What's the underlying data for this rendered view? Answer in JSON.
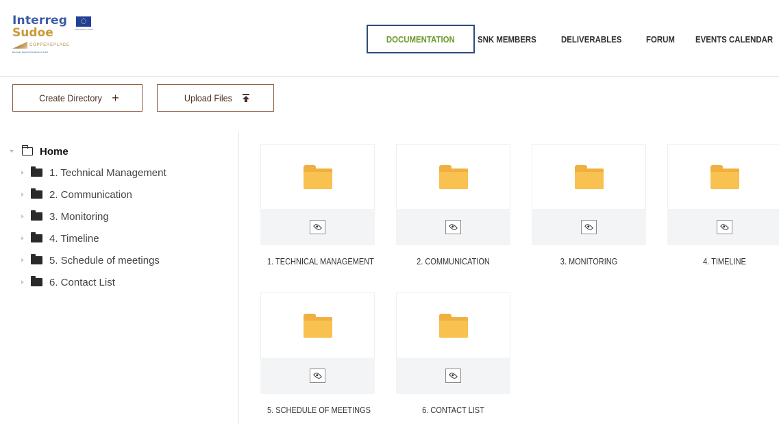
{
  "header": {
    "logo": {
      "line1": "Interreg",
      "line2": "Sudoe",
      "project": "COPPEREPLACE",
      "fund_caption": "European Regional Development Fund",
      "eu_caption": "EUROPEAN UNION"
    },
    "nav": [
      {
        "label": "DOCUMENTATION",
        "active": true
      },
      {
        "label": "SNK MEMBERS",
        "active": false
      },
      {
        "label": "DELIVERABLES",
        "active": false
      },
      {
        "label": "FORUM",
        "active": false
      },
      {
        "label": "EVENTS CALENDAR",
        "active": false
      }
    ],
    "colors": {
      "nav_active_text": "#6c9a2c",
      "nav_active_border": "#2e4a7a"
    }
  },
  "toolbar": {
    "create_label": "Create Directory",
    "create_icon": "plus-icon",
    "upload_label": "Upload Files",
    "upload_icon": "upload-icon",
    "button_border_color": "#8b5a3c"
  },
  "tree": {
    "root": "Home",
    "items": [
      {
        "label": "1. Technical Management"
      },
      {
        "label": "2. Communication"
      },
      {
        "label": "3. Monitoring"
      },
      {
        "label": "4. Timeline"
      },
      {
        "label": "5. Schedule of meetings"
      },
      {
        "label": "6. Contact List"
      }
    ]
  },
  "folders": [
    {
      "title": "1. TECHNICAL MANAGEMENT"
    },
    {
      "title": "2. COMMUNICATION"
    },
    {
      "title": "3. MONITORING"
    },
    {
      "title": "4. TIMELINE"
    },
    {
      "title": "5. SCHEDULE OF MEETINGS"
    },
    {
      "title": "6. CONTACT LIST"
    }
  ],
  "folder_color": "#f8c150"
}
